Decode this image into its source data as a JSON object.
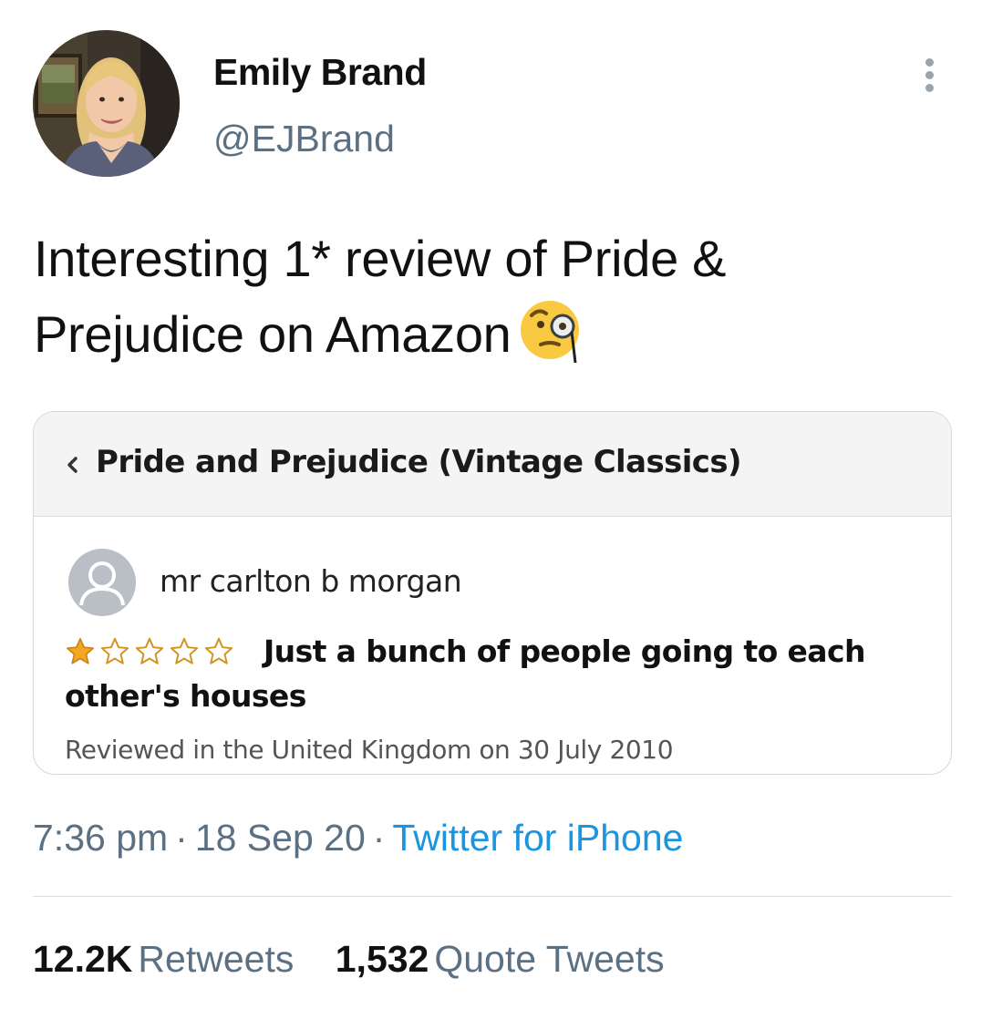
{
  "tweet": {
    "author": {
      "display_name": "Emily Brand",
      "handle": "@EJBrand"
    },
    "text": "Interesting 1* review of Pride & Prejudice on Amazon",
    "emoji": "face-with-monocle",
    "timestamp": "7:36 pm",
    "date": "18 Sep 20",
    "separator": "·",
    "source": "Twitter for iPhone",
    "stats": [
      {
        "count": "12.2K",
        "label": "Retweets"
      },
      {
        "count": "1,532",
        "label": "Quote Tweets"
      }
    ]
  },
  "embedded_review": {
    "product_title": "Pride and Prejudice (Vintage Classics)",
    "reviewer": "mr carlton b morgan",
    "rating": 1,
    "rating_max": 5,
    "review_title": "Just a bunch of people going to each other's houses",
    "review_meta": "Reviewed in the United Kingdom on 30 July 2010"
  },
  "colors": {
    "link_blue": "#1b95e0",
    "muted_gray": "#5b7083",
    "star_gold": "#f5a623"
  }
}
